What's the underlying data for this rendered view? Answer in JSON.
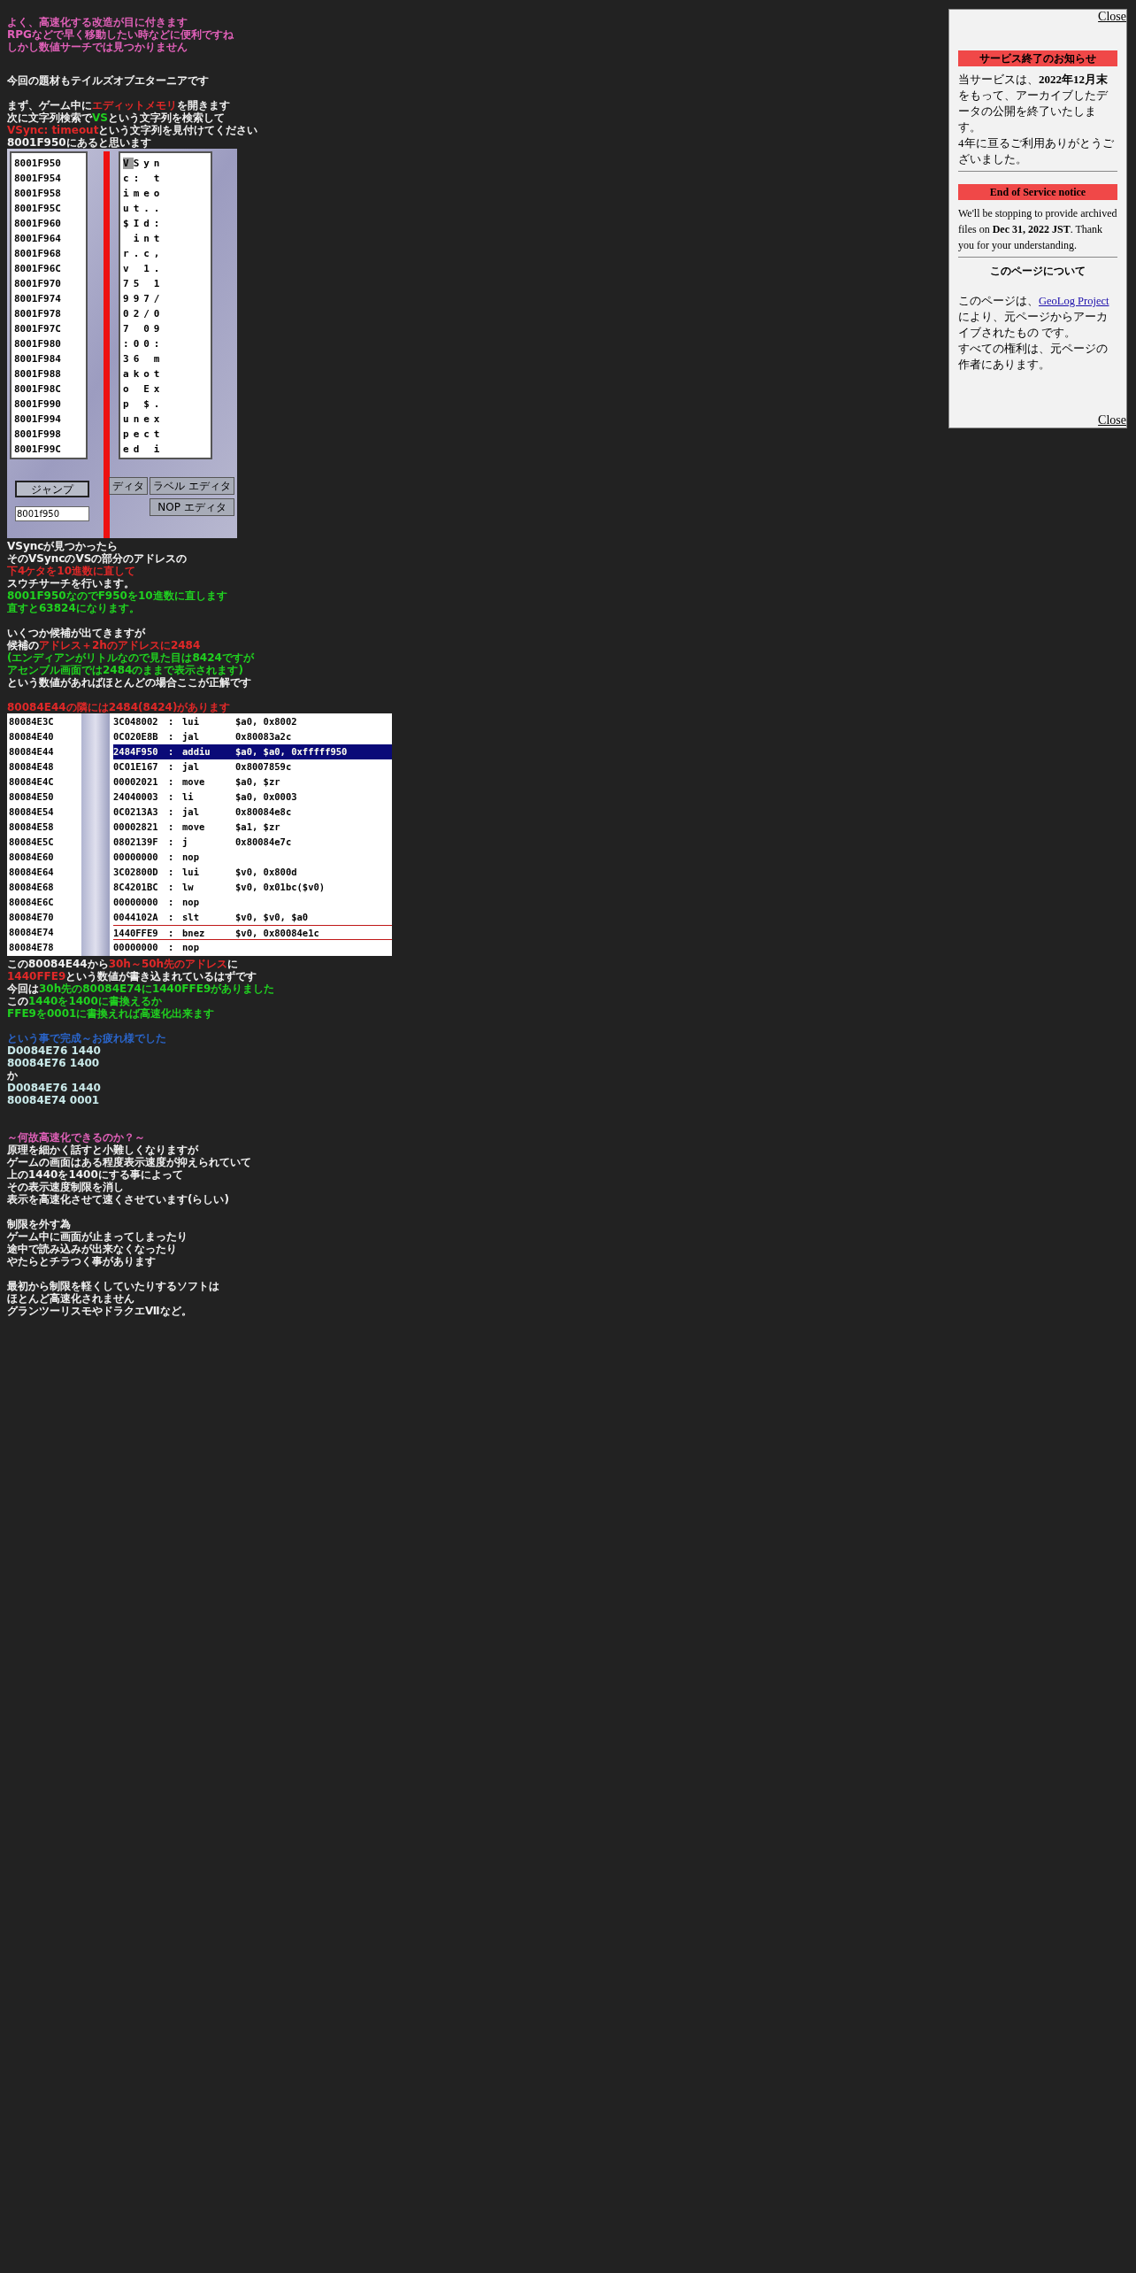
{
  "intro": [
    {
      "lines": [
        [
          {
            "text": "よく、高速化する改造が目に付きます",
            "color": "#e060b8"
          }
        ],
        [
          {
            "text": "RPGなどで早く移動したい時などに便利ですね",
            "color": "#e060b8"
          }
        ],
        [
          {
            "text": "しかし数値サーチでは見つかりません",
            "color": "#e060b8"
          }
        ]
      ]
    },
    {
      "lines": [
        [
          {
            "text": "今回の題材もテイルズオブエターニアです",
            "color": "#f0f0f0"
          }
        ]
      ]
    },
    {
      "lines": [
        [
          {
            "text": "まず、ゲーム中に",
            "color": "#f0f0f0"
          },
          {
            "text": "エディットメモリ",
            "color": "#e02828"
          },
          {
            "text": "を開きます",
            "color": "#f0f0f0"
          }
        ],
        [
          {
            "text": "次に文字列検索で",
            "color": "#f0f0f0"
          },
          {
            "text": "VS",
            "color": "#20d020"
          },
          {
            "text": "という文字列を検索して",
            "color": "#f0f0f0"
          }
        ],
        [
          {
            "text": "VSync: timeout",
            "color": "#e02828"
          },
          {
            "text": "という文字列を見付けてください",
            "color": "#f0f0f0"
          }
        ],
        [
          {
            "text": "8001F950にあると思います",
            "color": "#f0f0f0"
          }
        ]
      ]
    }
  ],
  "memory_editor": {
    "addresses": [
      "8001F950",
      "8001F954",
      "8001F958",
      "8001F95C",
      "8001F960",
      "8001F964",
      "8001F968",
      "8001F96C",
      "8001F970",
      "8001F974",
      "8001F978",
      "8001F97C",
      "8001F980",
      "8001F984",
      "8001F988",
      "8001F98C",
      "8001F990",
      "8001F994",
      "8001F998",
      "8001F99C"
    ],
    "chars": [
      {
        "text": "VSyn",
        "cursor": true
      },
      {
        "text": "c: t",
        "cursor": false
      },
      {
        "text": "imeo",
        "cursor": false
      },
      {
        "text": "ut..",
        "cursor": false
      },
      {
        "text": "$Id:",
        "cursor": false
      },
      {
        "text": " int",
        "cursor": false
      },
      {
        "text": "r.c,",
        "cursor": false
      },
      {
        "text": "v 1.",
        "cursor": false
      },
      {
        "text": "75 1",
        "cursor": false
      },
      {
        "text": "997/",
        "cursor": false
      },
      {
        "text": "02/0",
        "cursor": false
      },
      {
        "text": "7 09",
        "cursor": false
      },
      {
        "text": ":00:",
        "cursor": false
      },
      {
        "text": "36 m",
        "cursor": false
      },
      {
        "text": "akot",
        "cursor": false
      },
      {
        "text": "o Ex",
        "cursor": false
      },
      {
        "text": "p $.",
        "cursor": false
      },
      {
        "text": "unex",
        "cursor": false
      },
      {
        "text": "pect",
        "cursor": false
      },
      {
        "text": "ed i",
        "cursor": false
      }
    ],
    "jump_button": "ジャンプ",
    "address_field": "8001f950",
    "partial_button": "ディタ",
    "label_editor_button": "ラベル エディタ",
    "nop_editor_button": "NOP エディタ"
  },
  "middle": [
    {
      "lines": [
        [
          {
            "text": "VSyncが見つかったら",
            "color": "#f0f0f0"
          }
        ],
        [
          {
            "text": "そのVSyncのVSの部分のアドレスの",
            "color": "#f0f0f0"
          }
        ],
        [
          {
            "text": "下4ケタを10進数に直して",
            "color": "#e02828"
          }
        ],
        [
          {
            "text": "スウチサーチを行います。",
            "color": "#f0f0f0"
          }
        ],
        [
          {
            "text": "8001F950なのでF950を10進数に直します",
            "color": "#20d020"
          }
        ],
        [
          {
            "text": "直すと63824になります。",
            "color": "#20d020"
          }
        ]
      ]
    },
    {
      "lines": [
        [
          {
            "text": "いくつか候補が出てきますが",
            "color": "#f0f0f0"
          }
        ],
        [
          {
            "text": "候補の",
            "color": "#f0f0f0"
          },
          {
            "text": "アドレス＋2hのアドレスに2484",
            "color": "#e02828"
          }
        ],
        [
          {
            "text": "(エンディアンがリトルなので見た目は8424ですが",
            "color": "#20d020"
          }
        ],
        [
          {
            "text": "アセンブル画面では2484のままで表示されます)",
            "color": "#20d020"
          }
        ],
        [
          {
            "text": "という数値があればほとんどの場合ここが正解です",
            "color": "#f0f0f0"
          }
        ]
      ]
    },
    {
      "lines": [
        [
          {
            "text": "80084E44の隣には2484(8424)があります",
            "color": "#e02828"
          }
        ]
      ]
    }
  ],
  "disassembly": [
    {
      "address": "80084E3C",
      "hex": "3C048002",
      "op": "lui",
      "args": "$a0, 0x8002",
      "selected": false,
      "marked": false
    },
    {
      "address": "80084E40",
      "hex": "0C020E8B",
      "op": "jal",
      "args": "0x80083a2c",
      "selected": false,
      "marked": false
    },
    {
      "address": "80084E44",
      "hex": "2484F950",
      "op": "addiu",
      "args": "$a0, $a0, 0xfffff950",
      "selected": true,
      "marked": false
    },
    {
      "address": "80084E48",
      "hex": "0C01E167",
      "op": "jal",
      "args": "0x8007859c",
      "selected": false,
      "marked": false
    },
    {
      "address": "80084E4C",
      "hex": "00002021",
      "op": "move",
      "args": "$a0, $zr",
      "selected": false,
      "marked": false
    },
    {
      "address": "80084E50",
      "hex": "24040003",
      "op": "li",
      "args": "$a0, 0x0003",
      "selected": false,
      "marked": false
    },
    {
      "address": "80084E54",
      "hex": "0C0213A3",
      "op": "jal",
      "args": "0x80084e8c",
      "selected": false,
      "marked": false
    },
    {
      "address": "80084E58",
      "hex": "00002821",
      "op": "move",
      "args": "$a1, $zr",
      "selected": false,
      "marked": false
    },
    {
      "address": "80084E5C",
      "hex": "0802139F",
      "op": "j",
      "args": "0x80084e7c",
      "selected": false,
      "marked": false
    },
    {
      "address": "80084E60",
      "hex": "00000000",
      "op": "nop",
      "selected": false,
      "marked": false
    },
    {
      "address": "80084E64",
      "hex": "3C02800D",
      "op": "lui",
      "args": "$v0, 0x800d",
      "selected": false,
      "marked": false
    },
    {
      "address": "80084E68",
      "hex": "8C4201BC",
      "op": "lw",
      "args": "$v0, 0x01bc($v0)",
      "selected": false,
      "marked": false
    },
    {
      "address": "80084E6C",
      "hex": "00000000",
      "op": "nop",
      "selected": false,
      "marked": false
    },
    {
      "address": "80084E70",
      "hex": "0044102A",
      "op": "slt",
      "args": "$v0, $v0, $a0",
      "selected": false,
      "marked": false
    },
    {
      "address": "80084E74",
      "hex": "1440FFE9",
      "op": "bnez",
      "args": "$v0, 0x80084e1c",
      "selected": false,
      "marked": true
    },
    {
      "address": "80084E78",
      "hex": "00000000",
      "op": "nop",
      "selected": false,
      "marked": false
    }
  ],
  "disassembly_separator": ":",
  "outro": [
    {
      "lines": [
        [
          {
            "text": "この80084E44から",
            "color": "#f0f0f0"
          },
          {
            "text": "30h～50h先のアドレス",
            "color": "#e02828"
          },
          {
            "text": "に",
            "color": "#f0f0f0"
          }
        ],
        [
          {
            "text": "1440FFE9",
            "color": "#e02828"
          },
          {
            "text": "という数値が書き込まれているはずです",
            "color": "#f0f0f0"
          }
        ],
        [
          {
            "text": "今回は",
            "color": "#f0f0f0"
          },
          {
            "text": "30h先の80084E74に1440FFE9がありました",
            "color": "#20d020"
          }
        ],
        [
          {
            "text": "この",
            "color": "#f0f0f0"
          },
          {
            "text": "1440を1400に書換えるか",
            "color": "#20d020"
          }
        ],
        [
          {
            "text": "FFE9を0001に書換えれば高速化出来ます",
            "color": "#20d020"
          }
        ]
      ]
    },
    {
      "lines": [
        [
          {
            "text": "という事で完成～お疲れ様でした",
            "color": "#2a64c8"
          }
        ],
        [
          {
            "text": "D0084E76 1440",
            "color": "#c8e8e8"
          }
        ],
        [
          {
            "text": "80084E76 1400",
            "color": "#c8e8e8"
          }
        ],
        [
          {
            "text": "か",
            "color": "#f0f0f0"
          }
        ],
        [
          {
            "text": "D0084E76 1440",
            "color": "#c8e8e8"
          }
        ],
        [
          {
            "text": "80084E74 0001",
            "color": "#c8e8e8"
          }
        ]
      ]
    },
    {
      "lines": [
        [
          {
            "text": "～何故高速化できるのか？～",
            "color": "#e060b8"
          }
        ],
        [
          {
            "text": "原理を細かく話すと小難しくなりますが",
            "color": "#f0f0f0"
          }
        ],
        [
          {
            "text": "ゲームの画面はある程度表示速度が抑えられていて",
            "color": "#f0f0f0"
          }
        ],
        [
          {
            "text": "上の1440を1400にする事によって",
            "color": "#f0f0f0"
          }
        ],
        [
          {
            "text": "その表示速度制限を消し",
            "color": "#f0f0f0"
          }
        ],
        [
          {
            "text": "表示を高速化させて速くさせています(らしい)",
            "color": "#f0f0f0"
          }
        ]
      ]
    },
    {
      "lines": [
        [
          {
            "text": "制限を外す為",
            "color": "#f0f0f0"
          }
        ],
        [
          {
            "text": "ゲーム中に画面が止まってしまったり",
            "color": "#f0f0f0"
          }
        ],
        [
          {
            "text": "途中で読み込みが出来なくなったり",
            "color": "#f0f0f0"
          }
        ],
        [
          {
            "text": "やたらとチラつく事があります",
            "color": "#f0f0f0"
          }
        ]
      ]
    },
    {
      "lines": [
        [
          {
            "text": "最初から制限を軽くしていたりするソフトは",
            "color": "#f0f0f0"
          }
        ],
        [
          {
            "text": "ほとんど高速化されません",
            "color": "#f0f0f0"
          }
        ],
        [
          {
            "text": "グランツーリスモやドラクエⅦなど。",
            "color": "#f0f0f0"
          }
        ]
      ]
    }
  ],
  "notice_panel": {
    "close_top": "Close",
    "heading_ja": "サービス終了のお知らせ",
    "body_ja": "当サービスは、**2022年12月末**をもって、アーカイブしたデータの公開を終了いたします。",
    "body_ja_2": "4年に亘るご利用ありがとうございました。",
    "heading_en": "End of Service notice",
    "body_en": "We'll be stopping to provide archived files on **Dec 31, 2022 JST**. Thank you for your understanding.",
    "about_heading": "このページについて",
    "about_prefix": "このページは、",
    "about_link": "GeoLog Project",
    "about_suffix": "により、元ページからアーカイブされたもの です。",
    "rights": "すべての権利は、元ページの作者にあります。",
    "close_bottom": "Close"
  }
}
